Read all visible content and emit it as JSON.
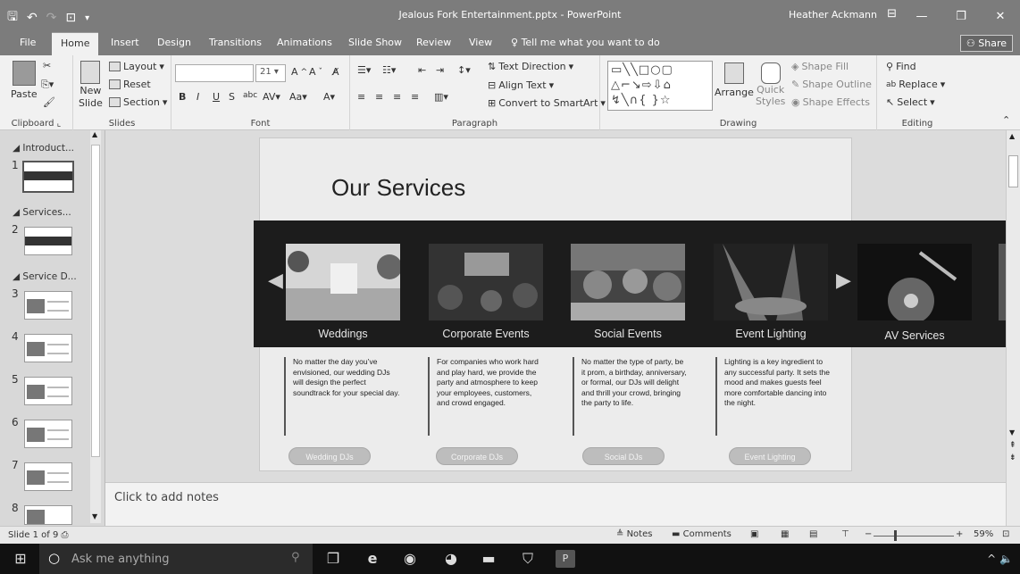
{
  "window": {
    "title": "Jealous Fork Entertainment.pptx - PowerPoint",
    "user": "Heather Ackmann"
  },
  "tabs": [
    "File",
    "Home",
    "Insert",
    "Design",
    "Transitions",
    "Animations",
    "Slide Show",
    "Review",
    "View"
  ],
  "active_tab": "Home",
  "tell_me": "Tell me what you want to do",
  "share": "Share",
  "ribbon": {
    "clipboard": {
      "label": "Clipboard",
      "paste": "Paste"
    },
    "slides": {
      "label": "Slides",
      "new_slide": "New",
      "new_slide2": "Slide",
      "layout": "Layout",
      "reset": "Reset",
      "section": "Section"
    },
    "font": {
      "label": "Font",
      "size": "21"
    },
    "paragraph": {
      "label": "Paragraph",
      "text_direction": "Text Direction",
      "align_text": "Align Text",
      "convert": "Convert to SmartArt"
    },
    "drawing": {
      "label": "Drawing",
      "arrange": "Arrange",
      "quick_styles": "Quick",
      "quick_styles2": "Styles",
      "shape_fill": "Shape Fill",
      "shape_outline": "Shape Outline",
      "shape_effects": "Shape Effects"
    },
    "editing": {
      "label": "Editing",
      "find": "Find",
      "replace": "Replace",
      "select": "Select"
    }
  },
  "thumbnails": {
    "sections": [
      "Introduct...",
      "Services...",
      "Service D..."
    ],
    "numbers": [
      "1",
      "2",
      "3",
      "4",
      "5",
      "6",
      "7",
      "8"
    ]
  },
  "slide": {
    "title": "Our Services",
    "services": [
      {
        "caption": "Weddings",
        "desc": "No matter the day you’ve envisioned, our wedding DJs will design the perfect soundtrack for your special day.",
        "button": "Wedding DJs"
      },
      {
        "caption": "Corporate Events",
        "desc": "For companies who work hard and play hard, we provide the party and atmosphere to keep your employees, customers, and crowd engaged.",
        "button": "Corporate DJs"
      },
      {
        "caption": "Social Events",
        "desc": "No matter the type of party, be it prom, a birthday, anniversary, or formal, our DJs will delight and thrill your crowd, bringing the party to life.",
        "button": "Social DJs"
      },
      {
        "caption": "Event Lighting",
        "desc": "Lighting is a key ingredient to any successful party. It sets the mood and makes guests feel more comfortable dancing into the night.",
        "button": "Event Lighting"
      },
      {
        "caption": "AV Services"
      }
    ]
  },
  "notes_placeholder": "Click to add notes",
  "status": {
    "slide_info": "Slide 1 of 9",
    "notes": "Notes",
    "comments": "Comments",
    "zoom": "59%"
  },
  "taskbar": {
    "search": "Ask me anything"
  }
}
